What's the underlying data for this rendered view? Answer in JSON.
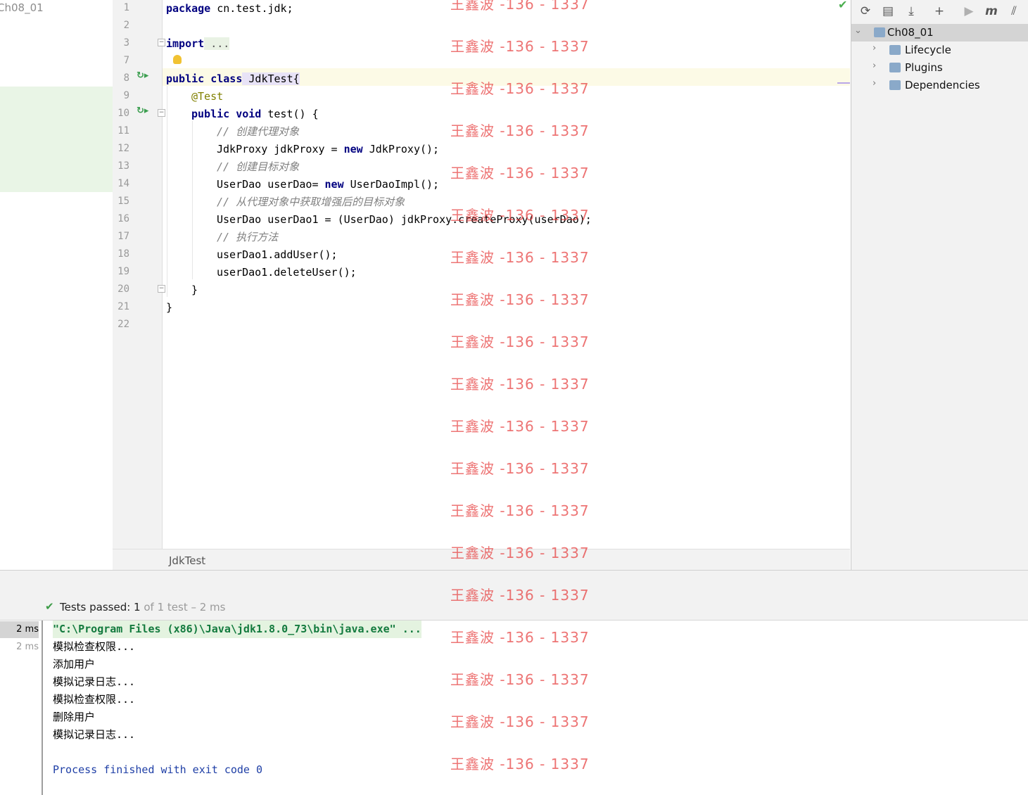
{
  "project_tree": {
    "label": "Ch08_01"
  },
  "editor": {
    "tab_name": "JdkTest",
    "lines": [
      {
        "n": "1",
        "text": ""
      },
      {
        "n": "2",
        "text": ""
      },
      {
        "n": "3",
        "text": ""
      },
      {
        "n": "7",
        "text": ""
      },
      {
        "n": "8",
        "text": ""
      },
      {
        "n": "9",
        "text": ""
      },
      {
        "n": "10",
        "text": ""
      },
      {
        "n": "11",
        "text": ""
      },
      {
        "n": "12",
        "text": ""
      },
      {
        "n": "13",
        "text": ""
      },
      {
        "n": "14",
        "text": ""
      },
      {
        "n": "15",
        "text": ""
      },
      {
        "n": "16",
        "text": ""
      },
      {
        "n": "17",
        "text": ""
      },
      {
        "n": "18",
        "text": ""
      },
      {
        "n": "19",
        "text": ""
      },
      {
        "n": "20",
        "text": ""
      },
      {
        "n": "21",
        "text": ""
      },
      {
        "n": "22",
        "text": ""
      }
    ],
    "code": {
      "l1_kw": "package",
      "l1_rest": " cn.test.jdk;",
      "l3_kw": "import",
      "l3_rest": " ...",
      "l8_kw": "public class",
      "l8_rest": " JdkTest{",
      "l9": "@Test",
      "l10_kw": "public void",
      "l10_rest": " test() {",
      "l11": "// 创建代理对象",
      "l12_a": "JdkProxy jdkProxy = ",
      "l12_kw": "new",
      "l12_b": " JdkProxy();",
      "l13": "// 创建目标对象",
      "l14_a": "UserDao userDao= ",
      "l14_kw": "new",
      "l14_b": " UserDaoImpl();",
      "l15": "// 从代理对象中获取增强后的目标对象",
      "l16": "UserDao userDao1 = (UserDao) jdkProxy.createProxy(userDao);",
      "l17": "// 执行方法",
      "l18": "userDao1.addUser();",
      "l19": "userDao1.deleteUser();",
      "l20": "}",
      "l21": "}"
    }
  },
  "maven": {
    "toolbar": [
      "refresh-icon",
      "reimport-folder-icon",
      "download-icon",
      "add-icon",
      "run-icon",
      "maven-m-icon",
      "toggle-offline-icon"
    ],
    "root": "Ch08_01",
    "items": [
      {
        "label": "Lifecycle"
      },
      {
        "label": "Plugins"
      },
      {
        "label": "Dependencies"
      }
    ]
  },
  "run": {
    "status_prefix": "Tests passed: ",
    "status_count": "1",
    "status_suffix": " of 1 test – 2 ms",
    "times": [
      "2 ms",
      "2 ms"
    ],
    "output": [
      "\"C:\\Program Files (x86)\\Java\\jdk1.8.0_73\\bin\\java.exe\" ...",
      "模拟检查权限...",
      "添加用户",
      "模拟记录日志...",
      "模拟检查权限...",
      "删除用户",
      "模拟记录日志...",
      "",
      "Process finished with exit code 0"
    ]
  },
  "watermark": "王鑫波 -136 - 1337",
  "colors": {
    "keyword": "#000080",
    "comment": "#808080",
    "annotation": "#808000",
    "pass": "#3c9b47",
    "watermark": "#e63a3a"
  }
}
